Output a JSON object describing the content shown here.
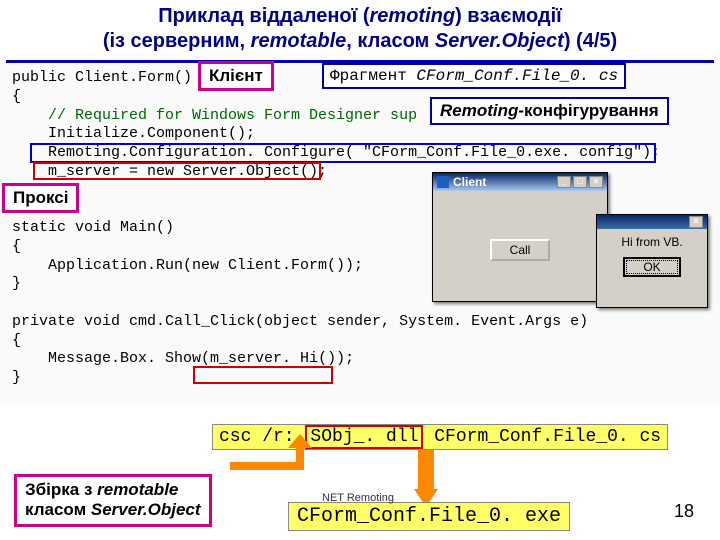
{
  "title": {
    "line1_a": "Приклад віддаленої (",
    "line1_b": "remoting",
    "line1_c": ") взаємодії",
    "line2_a": "(із серверним, ",
    "line2_b": "remotable",
    "line2_c": ",  класом ",
    "line2_d": "Server.Object",
    "line2_e": ") (4/5)"
  },
  "labels": {
    "client": "Клієнт",
    "proxy": "Проксі",
    "fragment_prefix": "Фрагмент ",
    "fragment_file": "CForm_Conf.File_0. cs",
    "remconf_b": "Remoting",
    "remconf_rest": "-конфігурування",
    "assembly_a": "Збірка з ",
    "assembly_b": "remotable",
    "assembly_c": "класом ",
    "assembly_d": "Server.Object"
  },
  "code": {
    "l1": "public Client.Form()",
    "l2": "{",
    "l3_c": "    // Required for Windows Form Designer sup",
    "l4": "    Initialize.Component();",
    "l5": "    Remoting.Configuration. Configure( \"CForm_Conf.File_0.exe. config\");",
    "l6": "    m_server = new Server.Object();",
    "l7": "}",
    "l8": "",
    "l9": "static void Main()",
    "l10": "{",
    "l11": "    Application.Run(new Client.Form());",
    "l12": "}",
    "l13": "",
    "l14": "private void cmd.Call_Click(object sender, System. Event.Args e)",
    "l15": "{",
    "l16_a": "    Message.Box. Show(",
    "l16_b": "m_server. Hi()",
    "l16_c": ");",
    "l17": "}"
  },
  "dialog1": {
    "title": "Client",
    "btn": "Call"
  },
  "dialog2": {
    "text": "Hi from VB.",
    "ok": "OK"
  },
  "yellow": {
    "csc_a": "csc /r: ",
    "csc_b": "SObj_. dll",
    "csc_c": " CForm_Conf.File_0. cs",
    "exe": "CForm_Conf.File_0. exe"
  },
  "footer": "NET Remoting",
  "page": "18"
}
